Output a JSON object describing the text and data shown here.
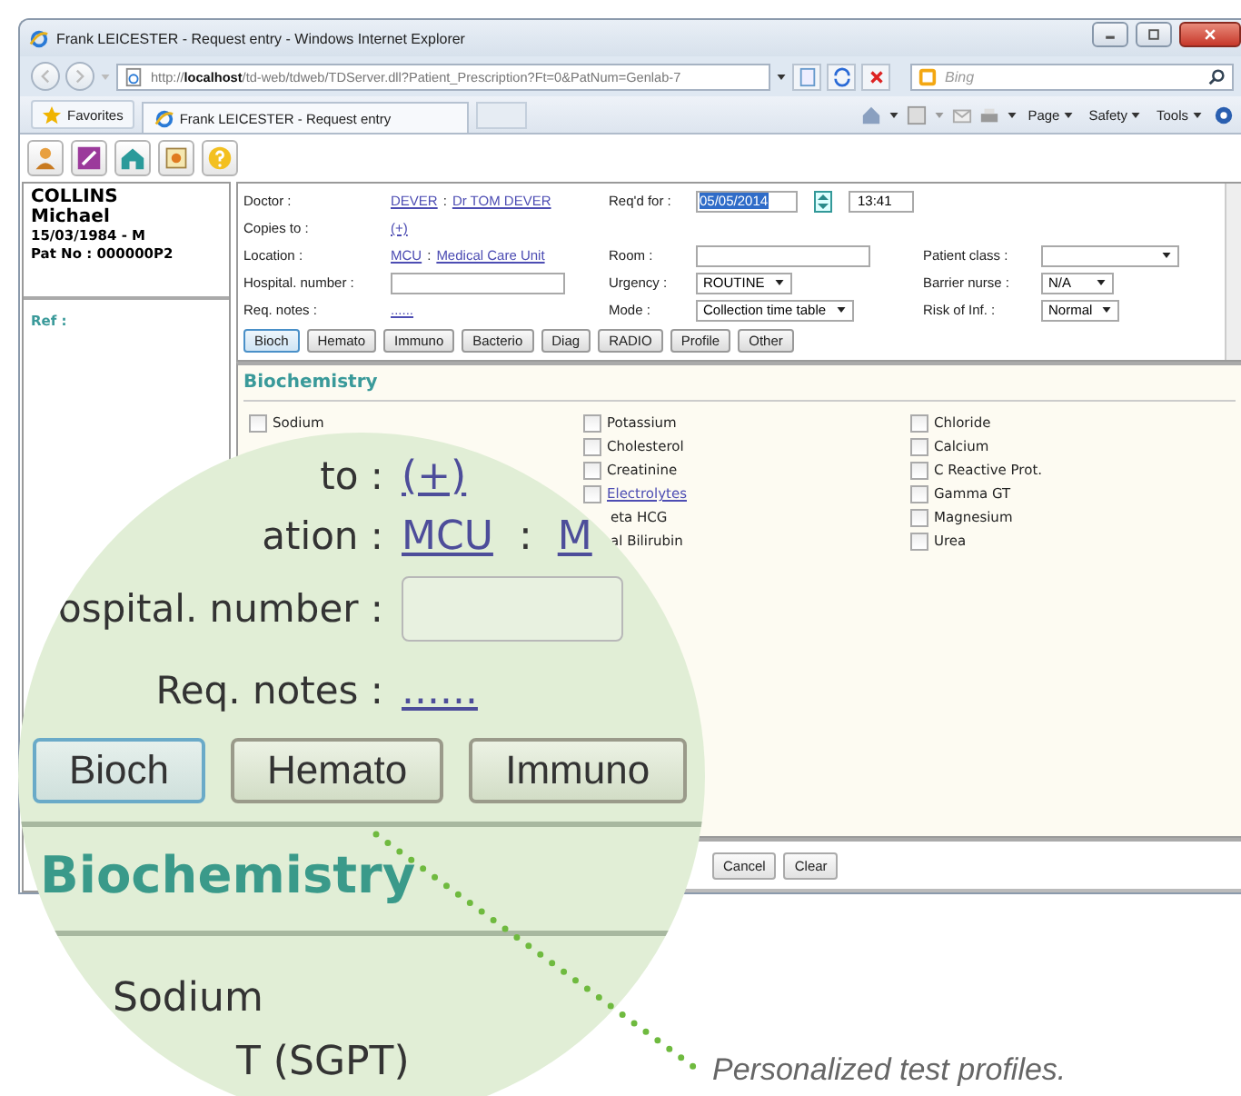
{
  "window": {
    "title": "Frank LEICESTER - Request entry - Windows Internet Explorer"
  },
  "address_bar": {
    "url": "http://**localhost**/td-web/tdweb/TDServer.dll?Patient_Prescription?Ft=0&PatNum=Genlab-7",
    "search_placeholder": "Bing"
  },
  "favorites_bar": {
    "favorites": "Favorites",
    "tab": "Frank LEICESTER - Request entry",
    "commands": [
      "Page",
      "Safety",
      "Tools"
    ]
  },
  "patient": {
    "surname": "COLLINS",
    "first_name": "Michael",
    "birth": "15/03/1984 - M",
    "pat_no": "Pat No : 000000P2",
    "ref_label": "Ref :"
  },
  "form": {
    "rows": [
      [
        {
          "kind": "label",
          "text": "Doctor :"
        },
        {
          "kind": "linkpair",
          "first": "DEVER",
          "sep": ":",
          "second": "Dr TOM DEVER"
        },
        {
          "kind": "label",
          "text": "Req'd for :"
        },
        {
          "kind": "date",
          "value": "05/05/2014",
          "selected": true,
          "time": "13:41"
        }
      ],
      [
        {
          "kind": "label",
          "text": "Copies to :"
        },
        {
          "kind": "link",
          "text": "(+)"
        }
      ],
      [
        {
          "kind": "label",
          "text": "Location :"
        },
        {
          "kind": "linkpair",
          "first": "MCU",
          "sep": ":",
          "second": "Medical Care Unit"
        },
        {
          "kind": "label",
          "text": "Room :"
        },
        {
          "kind": "field"
        },
        {
          "kind": "label",
          "text": "Patient class :"
        },
        {
          "kind": "select"
        }
      ],
      [
        {
          "kind": "label",
          "text": "Hospital. number :"
        },
        {
          "kind": "field"
        },
        {
          "kind": "label",
          "text": "Urgency :"
        },
        {
          "kind": "select",
          "value": "ROUTINE"
        },
        {
          "kind": "label",
          "text": "Barrier nurse :"
        },
        {
          "kind": "select",
          "value": "N/A"
        }
      ],
      [
        {
          "kind": "label",
          "text": "Req. notes :"
        },
        {
          "kind": "link",
          "text": "......"
        },
        {
          "kind": "label",
          "text": "Mode :"
        },
        {
          "kind": "select",
          "value": "Collection time table"
        },
        {
          "kind": "label",
          "text": "Risk of Inf. :"
        },
        {
          "kind": "select",
          "value": "Normal"
        }
      ]
    ]
  },
  "tabs": [
    {
      "label": "Bioch",
      "selected": true
    },
    {
      "label": "Hemato",
      "selected": false
    },
    {
      "label": "Immuno",
      "selected": false
    },
    {
      "label": "Bacterio",
      "selected": false
    },
    {
      "label": "Diag",
      "selected": false
    },
    {
      "label": "RADIO",
      "selected": false
    },
    {
      "label": "Profile",
      "selected": false
    },
    {
      "label": "Other",
      "selected": false
    }
  ],
  "tests": {
    "title": "Biochemistry",
    "columns": [
      [
        {
          "kind": "check",
          "label": "Sodium",
          "checked": false
        }
      ],
      [
        {
          "kind": "check",
          "label": "Potassium",
          "checked": false
        },
        {
          "kind": "check",
          "label": "Cholesterol",
          "checked": false
        },
        {
          "kind": "check",
          "label": "Creatinine",
          "checked": false
        },
        {
          "kind": "link",
          "label": "Electrolytes",
          "checked": false
        },
        {
          "kind": "text",
          "label": "eta HCG"
        },
        {
          "kind": "text",
          "label": "al Bilirubin"
        }
      ],
      [
        {
          "kind": "check",
          "label": "Chloride",
          "checked": false
        },
        {
          "kind": "check",
          "label": "Calcium",
          "checked": false
        },
        {
          "kind": "check",
          "label": "C Reactive Prot.",
          "checked": false
        },
        {
          "kind": "check",
          "label": "Gamma GT",
          "checked": false
        },
        {
          "kind": "check",
          "label": "Magnesium",
          "checked": false
        },
        {
          "kind": "check",
          "label": "Urea",
          "checked": false
        }
      ]
    ]
  },
  "actions": [
    "Cancel",
    "Clear"
  ],
  "magnifier": {
    "rows": [
      {
        "label": "to :",
        "cells": [
          {
            "kind": "link",
            "text": "(+)"
          }
        ]
      },
      {
        "label": "ation :",
        "cells": [
          {
            "kind": "link",
            "text": "MCU"
          },
          {
            "kind": "text",
            "text": ":"
          },
          {
            "kind": "link",
            "text": "M"
          }
        ]
      },
      {
        "label": "ospital. number :",
        "cells": [
          {
            "kind": "field"
          }
        ]
      },
      {
        "label": "Req. notes :",
        "cells": [
          {
            "kind": "link",
            "text": "......"
          }
        ]
      }
    ],
    "buttons": [
      {
        "label": "Bioch",
        "selected": true
      },
      {
        "label": "Hemato",
        "selected": false
      },
      {
        "label": "Immuno",
        "selected": false
      }
    ],
    "section_title": "Biochemistry",
    "tests": [
      "Sodium",
      "T (SGPT)"
    ]
  },
  "caption": "Personalized test profiles."
}
